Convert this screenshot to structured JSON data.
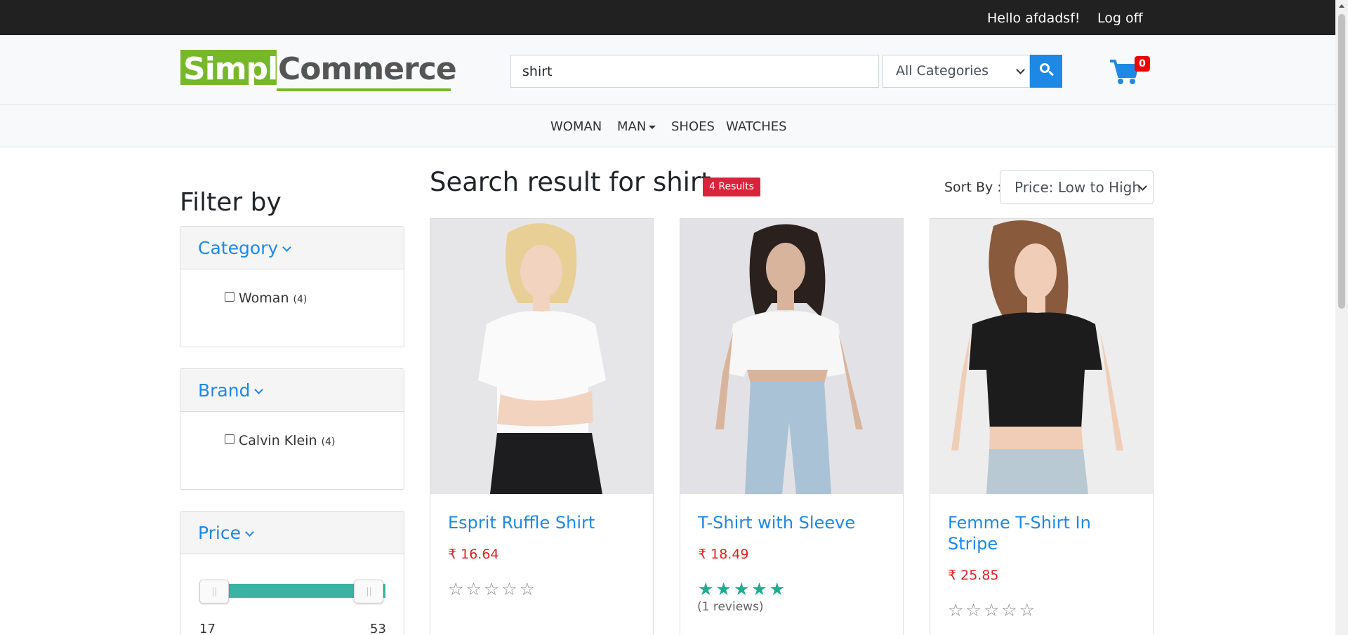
{
  "topbar": {
    "greeting": "Hello afdadsf!",
    "logoff": "Log off"
  },
  "header": {
    "logo_part1": "Simpl",
    "logo_part2": "Commerce",
    "search_value": "shirt",
    "category_select": "All Categories",
    "cart_count": "0",
    "colors": {
      "accent": "#1e88e5",
      "logo_green": "#76b82a",
      "cart_badge": "#e00000"
    }
  },
  "nav": {
    "items": [
      "WOMAN",
      "MAN",
      "SHOES",
      "WATCHES"
    ]
  },
  "sidebar": {
    "title": "Filter by",
    "category": {
      "heading": "Category",
      "options": [
        {
          "label": "Woman",
          "count": "(4)"
        }
      ]
    },
    "brand": {
      "heading": "Brand",
      "options": [
        {
          "label": "Calvin Klein",
          "count": "(4)"
        }
      ]
    },
    "price": {
      "heading": "Price",
      "min": "17",
      "max": "53"
    }
  },
  "results": {
    "title": "Search result for shirt",
    "badge": "4 Results",
    "sort_label": "Sort By :",
    "sort_value": "Price: Low to High"
  },
  "products": [
    {
      "name": "Esprit Ruffle Shirt",
      "price": "₹ 16.64",
      "rating": 0,
      "reviews": "",
      "image": "woman-white-tshirt-black-jeans"
    },
    {
      "name": "T-Shirt with Sleeve",
      "price": "₹ 18.49",
      "rating": 5,
      "reviews": "(1 reviews)",
      "image": "woman-white-tshirt-light-jeans"
    },
    {
      "name": "Femme T-Shirt In Stripe",
      "price": "₹ 25.85",
      "rating": 0,
      "reviews": "",
      "image": "woman-black-crop-top"
    }
  ]
}
